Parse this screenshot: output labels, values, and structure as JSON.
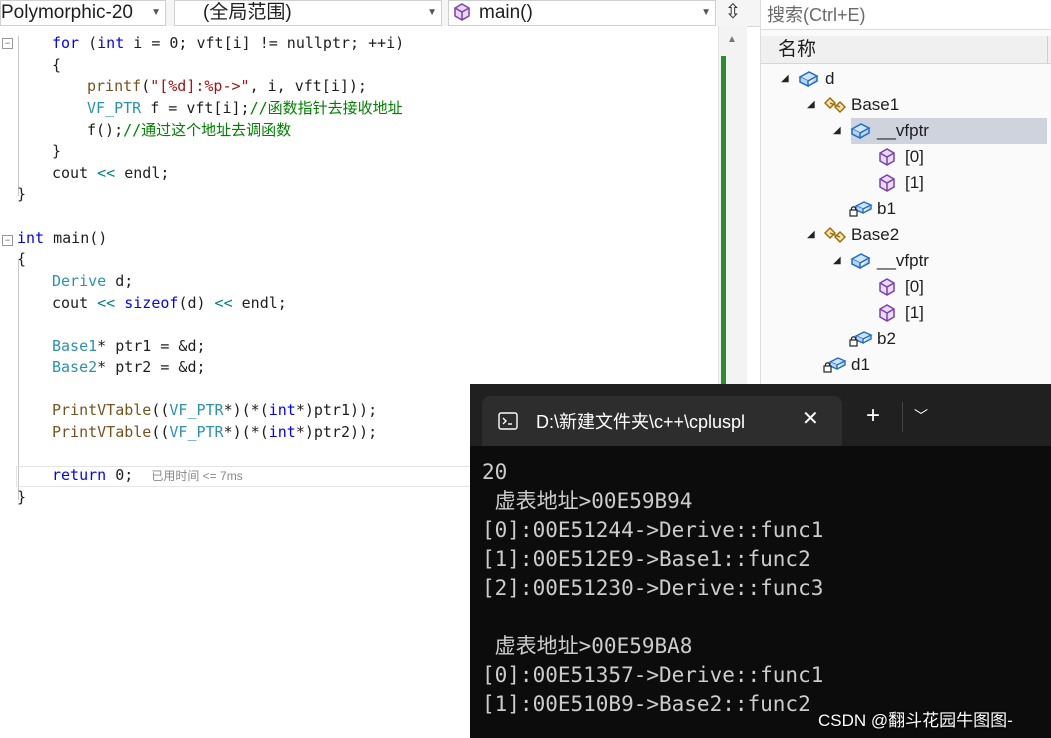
{
  "toolbar": {
    "project": "Polymorphic-20",
    "scope": "(全局范围)",
    "function": "main()"
  },
  "code": {
    "line1": [
      "for",
      " (",
      "int",
      " i = 0; vft[i] != nullptr; ++i)"
    ],
    "l_open1": "{",
    "printf_fn": "printf",
    "printf_str": "\"[%d]:%p->\"",
    "printf_rest": ", i, vft[i]);",
    "vfptr_type": "VF_PTR",
    "vfptr_rest": " f = vft[i];",
    "vfptr_comment": "//函数指针去接收地址",
    "call": "f();",
    "call_comment": "//通过这个地址去调函数",
    "l_close1": "}",
    "cout_kw": "cout",
    "cout_op": " << ",
    "cout_endl": "endl;",
    "l_close2": "}",
    "main_int": "int",
    "main_name": " main()",
    "main_open": "{",
    "derive_type": "Derive",
    "derive_rest": " d;",
    "sizeof_cout": "cout",
    "sizeof_op1": " << ",
    "sizeof_kw": "sizeof",
    "sizeof_arg": "(d)",
    "sizeof_op2": " << ",
    "sizeof_endl": "endl;",
    "base1_type": "Base1",
    "base1_rest": "* ptr1 = &d;",
    "base2_type": "Base2",
    "base2_rest": "* ptr2 = &d;",
    "pv1_fn": "PrintVTable",
    "pv1_a": "((",
    "pv1_t": "VF_PTR",
    "pv1_b": "*)(*(",
    "pv1_int": "int",
    "pv1_c": "*)ptr1));",
    "pv2_fn": "PrintVTable",
    "pv2_a": "((",
    "pv2_t": "VF_PTR",
    "pv2_b": "*)(*(",
    "pv2_int": "int",
    "pv2_c": "*)ptr2));",
    "ret_kw": "return",
    "ret_rest": " 0;",
    "ret_hint": "已用时间 <= 7ms",
    "main_close": "}"
  },
  "watch": {
    "search_placeholder": "搜索(Ctrl+E)",
    "column_name": "名称",
    "nodes": {
      "d": "d",
      "base1": "Base1",
      "vfptr1": "__vfptr",
      "v1_0": "[0]",
      "v1_1": "[1]",
      "b1": "b1",
      "base2": "Base2",
      "vfptr2": "__vfptr",
      "v2_0": "[0]",
      "v2_1": "[1]",
      "b2": "b2",
      "d1": "d1"
    }
  },
  "terminal": {
    "tab_title": "D:\\新建文件夹\\c++\\cpluspl",
    "lines": [
      "20",
      " 虚表地址>00E59B94",
      "[0]:00E51244->Derive::func1",
      "[1]:00E512E9->Base1::func2",
      "[2]:00E51230->Derive::func3",
      "",
      " 虚表地址>00E59BA8",
      "[0]:00E51357->Derive::func1",
      "[1]:00E510B9->Base2::func2"
    ]
  },
  "watermark": "CSDN @翻斗花园牛图图-",
  "colors": {
    "keyword": "#0000ff",
    "type": "#2b91af",
    "string": "#a31515",
    "comment": "#008000",
    "terminal_bg": "#0c0c0c",
    "selection": "#cfd3de"
  }
}
